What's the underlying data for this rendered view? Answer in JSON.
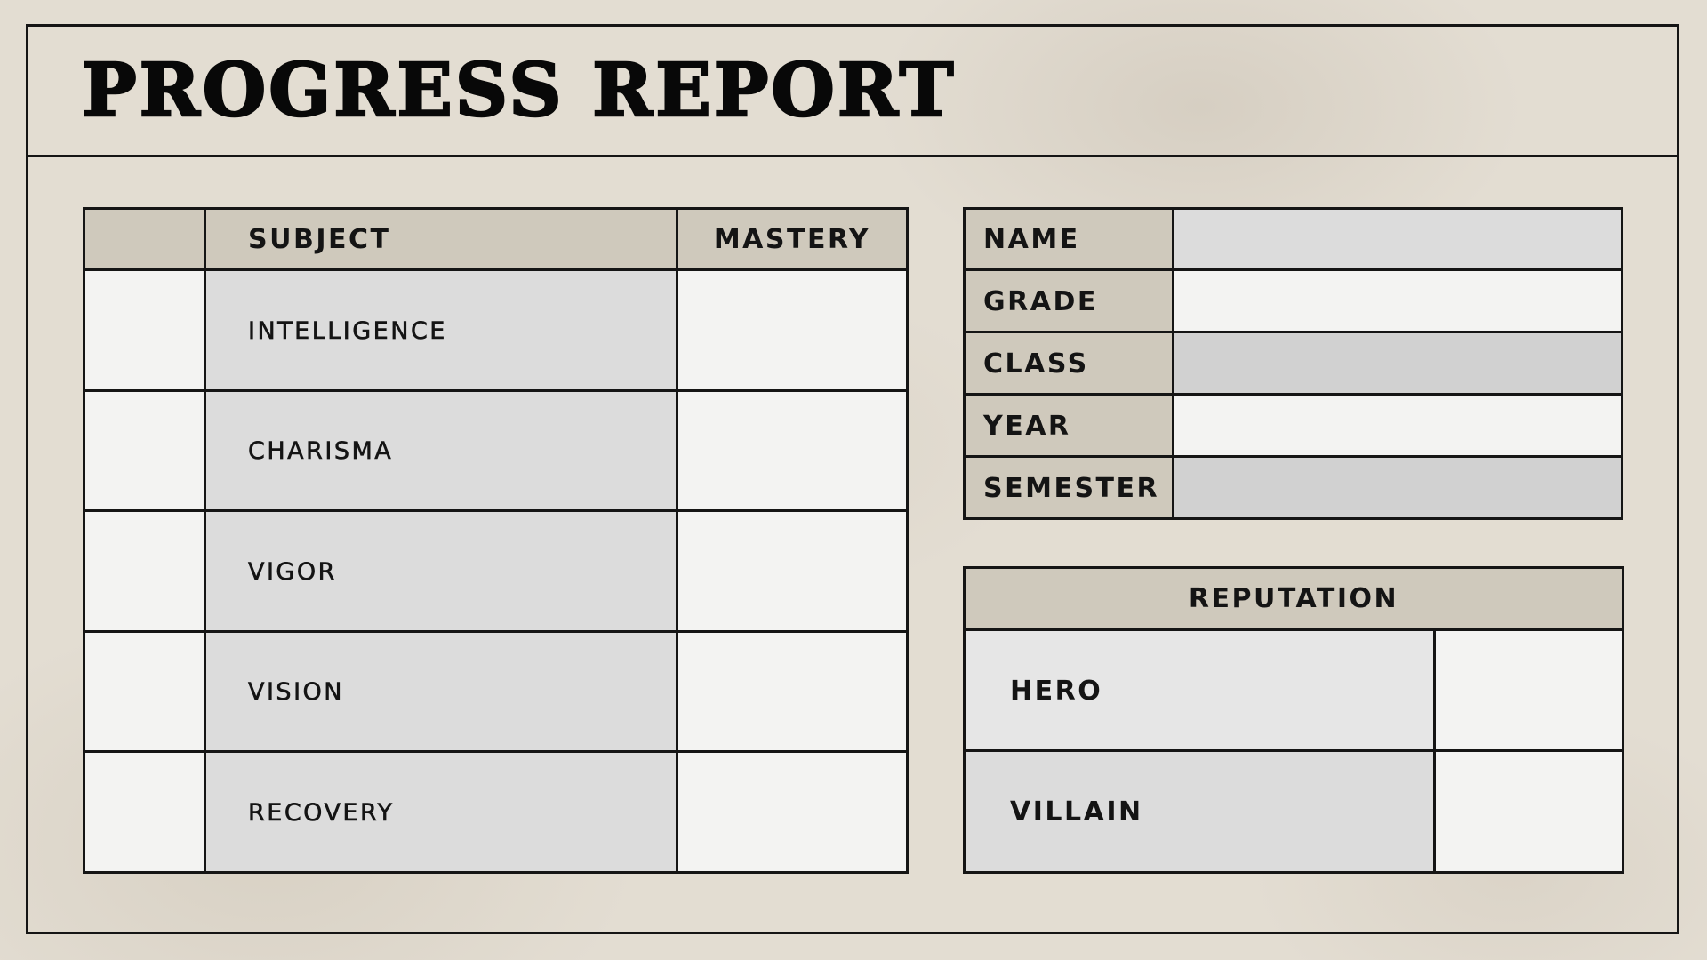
{
  "page": {
    "title": "PROGRESS REPORT"
  },
  "subjects_table": {
    "headers": {
      "subject": "SUBJECT",
      "mastery": "MASTERY"
    },
    "rows": [
      {
        "subject": "INTELLIGENCE"
      },
      {
        "subject": "CHARISMA"
      },
      {
        "subject": "VIGOR"
      },
      {
        "subject": "VISION"
      },
      {
        "subject": "RECOVERY"
      }
    ]
  },
  "info_table": {
    "rows": [
      {
        "label": "NAME"
      },
      {
        "label": "GRADE"
      },
      {
        "label": "CLASS"
      },
      {
        "label": "YEAR"
      },
      {
        "label": "SEMESTER"
      }
    ]
  },
  "reputation_table": {
    "header": "REPUTATION",
    "rows": [
      {
        "label": "HERO"
      },
      {
        "label": "VILLAIN"
      }
    ]
  },
  "colors": {
    "background": "#e3ddd2",
    "header_fill": "#cfc9bc",
    "cell_gray": "#dcdcdc",
    "cell_light": "#f3f3f2",
    "lines": "#151515"
  }
}
